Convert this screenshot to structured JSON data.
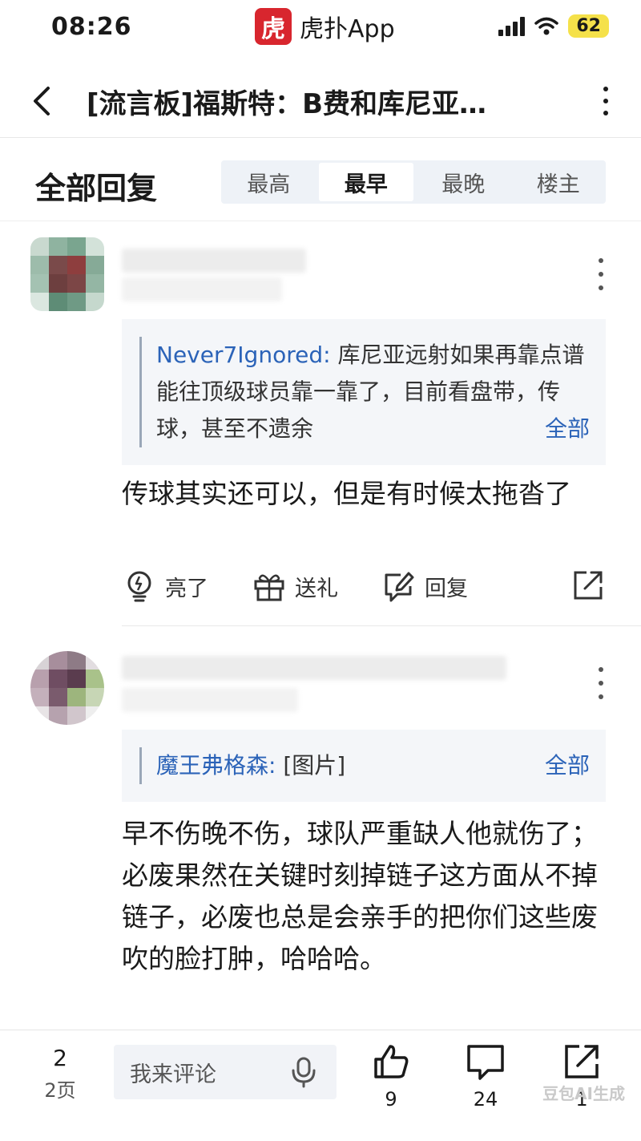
{
  "status_bar": {
    "time": "08:26",
    "app_logo_char": "虎",
    "app_name": "虎扑App",
    "battery": "62"
  },
  "nav": {
    "title": "[流言板]福斯特：B费和库尼亚…"
  },
  "replies": {
    "title": "全部回复",
    "sort_tabs": [
      {
        "label": "最高",
        "active": false
      },
      {
        "label": "最早",
        "active": true
      },
      {
        "label": "最晚",
        "active": false
      },
      {
        "label": "楼主",
        "active": false
      }
    ]
  },
  "comments": [
    {
      "quote_author": "Never7Ignored:",
      "quote_text": "库尼亚远射如果再靠点谱能往顶级球员靠一靠了，目前看盘带，传球，甚至不遗余",
      "quote_all": "全部",
      "body": "传球其实还可以，但是有时候太拖沓了",
      "actions": {
        "light": "亮了",
        "gift": "送礼",
        "reply": "回复"
      }
    },
    {
      "quote_author": "魔王弗格森:",
      "quote_text": "[图片]",
      "quote_all": "全部",
      "body": "早不伤晚不伤，球队严重缺人他就伤了；必废果然在关键时刻掉链子这方面从不掉链子，必废也总是会亲手的把你们这些废吹的脸打肿，哈哈哈。"
    }
  ],
  "bottom_bar": {
    "page_num": "2",
    "page_label": "2页",
    "comment_placeholder": "我来评论",
    "like_count": "9",
    "comment_count": "24",
    "share_count": "1"
  },
  "watermark": "豆包AI生成"
}
